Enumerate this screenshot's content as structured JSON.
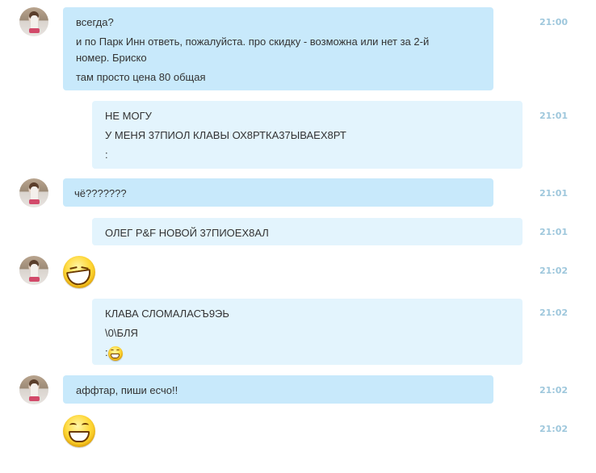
{
  "messages": [
    {
      "sender": "contact",
      "lines": [
        "всегда?",
        "и по Парк Инн ответь, пожалуйста. про скидку - возможна или нет за 2-й номер. Бриско",
        "там просто цена 80 общая"
      ],
      "time": "21:00"
    },
    {
      "sender": "me",
      "lines": [
        "НЕ МОГУ",
        "У МЕНЯ 37ПИОЛ КЛАВЫ ОХ8РТКА37ЫВАЕХ8РТ",
        ":"
      ],
      "time": "21:01"
    },
    {
      "sender": "contact",
      "lines": [
        "чё???????"
      ],
      "time": "21:01"
    },
    {
      "sender": "me",
      "lines": [
        "ОЛЕГ Р&F НОВОЙ 37ПИОЕХ8АЛ"
      ],
      "time": "21:01"
    },
    {
      "sender": "contact",
      "emoticon": "laugh-emoticon",
      "time": "21:02"
    },
    {
      "sender": "me",
      "lines": [
        "КЛАВА СЛОМАЛАСЪ9ЭЬ",
        "\\0\\БЛЯ",
        ":"
      ],
      "inline_emoticon": "grin-emoticon",
      "time": "21:02"
    },
    {
      "sender": "contact",
      "lines": [
        "аффтар, пиши есчо!!"
      ],
      "time": "21:02"
    },
    {
      "sender": "contact",
      "emoticon": "grin-emoticon",
      "time": "21:02"
    }
  ],
  "colors": {
    "incoming_bubble": "#c8e9fb",
    "outgoing_bubble": "#e3f4fd",
    "timestamp": "#9ec7dc"
  }
}
